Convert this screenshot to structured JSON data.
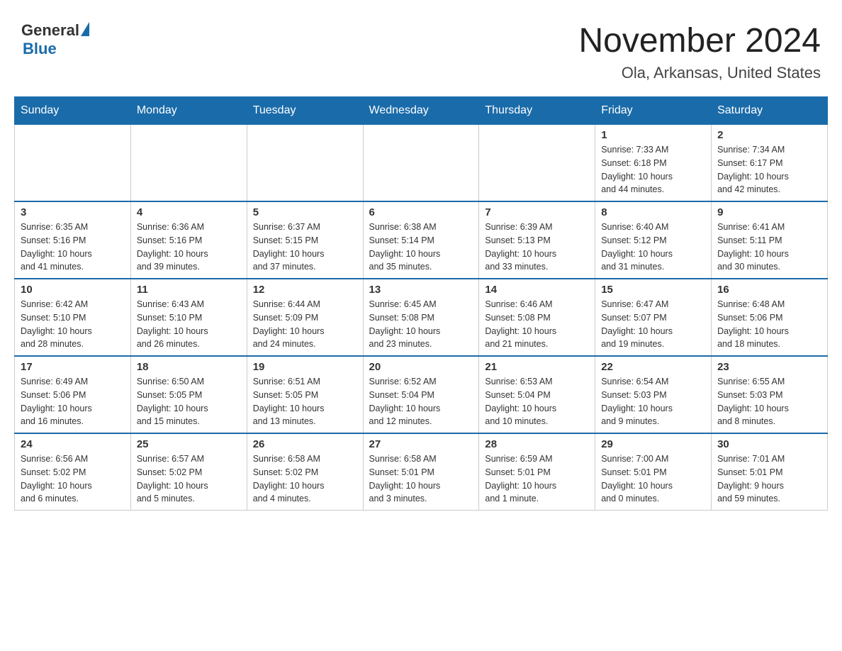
{
  "header": {
    "logo_general": "General",
    "logo_blue": "Blue",
    "title": "November 2024",
    "subtitle": "Ola, Arkansas, United States"
  },
  "weekdays": [
    "Sunday",
    "Monday",
    "Tuesday",
    "Wednesday",
    "Thursday",
    "Friday",
    "Saturday"
  ],
  "weeks": [
    [
      {
        "day": "",
        "info": ""
      },
      {
        "day": "",
        "info": ""
      },
      {
        "day": "",
        "info": ""
      },
      {
        "day": "",
        "info": ""
      },
      {
        "day": "",
        "info": ""
      },
      {
        "day": "1",
        "info": "Sunrise: 7:33 AM\nSunset: 6:18 PM\nDaylight: 10 hours\nand 44 minutes."
      },
      {
        "day": "2",
        "info": "Sunrise: 7:34 AM\nSunset: 6:17 PM\nDaylight: 10 hours\nand 42 minutes."
      }
    ],
    [
      {
        "day": "3",
        "info": "Sunrise: 6:35 AM\nSunset: 5:16 PM\nDaylight: 10 hours\nand 41 minutes."
      },
      {
        "day": "4",
        "info": "Sunrise: 6:36 AM\nSunset: 5:16 PM\nDaylight: 10 hours\nand 39 minutes."
      },
      {
        "day": "5",
        "info": "Sunrise: 6:37 AM\nSunset: 5:15 PM\nDaylight: 10 hours\nand 37 minutes."
      },
      {
        "day": "6",
        "info": "Sunrise: 6:38 AM\nSunset: 5:14 PM\nDaylight: 10 hours\nand 35 minutes."
      },
      {
        "day": "7",
        "info": "Sunrise: 6:39 AM\nSunset: 5:13 PM\nDaylight: 10 hours\nand 33 minutes."
      },
      {
        "day": "8",
        "info": "Sunrise: 6:40 AM\nSunset: 5:12 PM\nDaylight: 10 hours\nand 31 minutes."
      },
      {
        "day": "9",
        "info": "Sunrise: 6:41 AM\nSunset: 5:11 PM\nDaylight: 10 hours\nand 30 minutes."
      }
    ],
    [
      {
        "day": "10",
        "info": "Sunrise: 6:42 AM\nSunset: 5:10 PM\nDaylight: 10 hours\nand 28 minutes."
      },
      {
        "day": "11",
        "info": "Sunrise: 6:43 AM\nSunset: 5:10 PM\nDaylight: 10 hours\nand 26 minutes."
      },
      {
        "day": "12",
        "info": "Sunrise: 6:44 AM\nSunset: 5:09 PM\nDaylight: 10 hours\nand 24 minutes."
      },
      {
        "day": "13",
        "info": "Sunrise: 6:45 AM\nSunset: 5:08 PM\nDaylight: 10 hours\nand 23 minutes."
      },
      {
        "day": "14",
        "info": "Sunrise: 6:46 AM\nSunset: 5:08 PM\nDaylight: 10 hours\nand 21 minutes."
      },
      {
        "day": "15",
        "info": "Sunrise: 6:47 AM\nSunset: 5:07 PM\nDaylight: 10 hours\nand 19 minutes."
      },
      {
        "day": "16",
        "info": "Sunrise: 6:48 AM\nSunset: 5:06 PM\nDaylight: 10 hours\nand 18 minutes."
      }
    ],
    [
      {
        "day": "17",
        "info": "Sunrise: 6:49 AM\nSunset: 5:06 PM\nDaylight: 10 hours\nand 16 minutes."
      },
      {
        "day": "18",
        "info": "Sunrise: 6:50 AM\nSunset: 5:05 PM\nDaylight: 10 hours\nand 15 minutes."
      },
      {
        "day": "19",
        "info": "Sunrise: 6:51 AM\nSunset: 5:05 PM\nDaylight: 10 hours\nand 13 minutes."
      },
      {
        "day": "20",
        "info": "Sunrise: 6:52 AM\nSunset: 5:04 PM\nDaylight: 10 hours\nand 12 minutes."
      },
      {
        "day": "21",
        "info": "Sunrise: 6:53 AM\nSunset: 5:04 PM\nDaylight: 10 hours\nand 10 minutes."
      },
      {
        "day": "22",
        "info": "Sunrise: 6:54 AM\nSunset: 5:03 PM\nDaylight: 10 hours\nand 9 minutes."
      },
      {
        "day": "23",
        "info": "Sunrise: 6:55 AM\nSunset: 5:03 PM\nDaylight: 10 hours\nand 8 minutes."
      }
    ],
    [
      {
        "day": "24",
        "info": "Sunrise: 6:56 AM\nSunset: 5:02 PM\nDaylight: 10 hours\nand 6 minutes."
      },
      {
        "day": "25",
        "info": "Sunrise: 6:57 AM\nSunset: 5:02 PM\nDaylight: 10 hours\nand 5 minutes."
      },
      {
        "day": "26",
        "info": "Sunrise: 6:58 AM\nSunset: 5:02 PM\nDaylight: 10 hours\nand 4 minutes."
      },
      {
        "day": "27",
        "info": "Sunrise: 6:58 AM\nSunset: 5:01 PM\nDaylight: 10 hours\nand 3 minutes."
      },
      {
        "day": "28",
        "info": "Sunrise: 6:59 AM\nSunset: 5:01 PM\nDaylight: 10 hours\nand 1 minute."
      },
      {
        "day": "29",
        "info": "Sunrise: 7:00 AM\nSunset: 5:01 PM\nDaylight: 10 hours\nand 0 minutes."
      },
      {
        "day": "30",
        "info": "Sunrise: 7:01 AM\nSunset: 5:01 PM\nDaylight: 9 hours\nand 59 minutes."
      }
    ]
  ]
}
